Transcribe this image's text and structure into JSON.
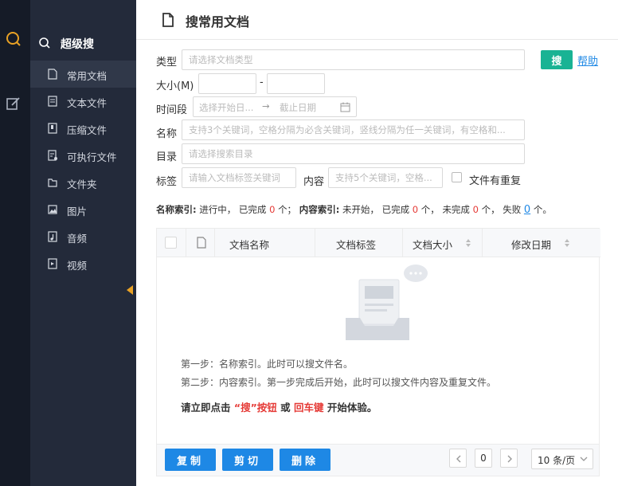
{
  "sidebar": {
    "title": "超级搜",
    "items": [
      {
        "label": "常用文档",
        "icon": "document-icon",
        "active": true
      },
      {
        "label": "文本文件",
        "icon": "text-file-icon"
      },
      {
        "label": "压缩文件",
        "icon": "archive-icon"
      },
      {
        "label": "可执行文件",
        "icon": "executable-icon"
      },
      {
        "label": "文件夹",
        "icon": "folder-icon"
      },
      {
        "label": "图片",
        "icon": "image-icon"
      },
      {
        "label": "音频",
        "icon": "audio-icon"
      },
      {
        "label": "视频",
        "icon": "video-icon"
      }
    ]
  },
  "page": {
    "title": "搜常用文档"
  },
  "form": {
    "type_label": "类型",
    "type_placeholder": "请选择文档类型",
    "size_label": "大小(M)",
    "size_sep": "-",
    "time_label": "时间段",
    "time_start_placeholder": "选择开始日...",
    "time_arrow": "→",
    "time_end_placeholder": "截止日期",
    "name_label": "名称",
    "name_placeholder": "支持3个关键词，空格分隔为必含关键词，竖线分隔为任一关键词，有空格和...",
    "dir_label": "目录",
    "dir_placeholder": "请选择搜索目录",
    "tag_label": "标签",
    "tag_placeholder": "请输入文档标签关键词",
    "content_label": "内容",
    "content_placeholder": "支持5个关键词，空格...",
    "dup_label": "文件有重复",
    "search_button": "搜",
    "help_link": "帮助"
  },
  "status": {
    "name_index_label": "名称索引:",
    "name_index_state": "进行中，",
    "done_prefix": "已完成",
    "name_done_count": "0",
    "unit_sep": "个；",
    "content_index_label": "内容索引:",
    "content_state": "未开始，",
    "content_done_count": "0",
    "unit": "个，",
    "undone_prefix": "未完成",
    "undone_count": "0",
    "fail_prefix": "失败",
    "fail_count": "0",
    "end": "个。"
  },
  "table": {
    "columns": [
      "文档名称",
      "文档标签",
      "文档大小",
      "修改日期"
    ],
    "step1": "第一步：名称索引。此时可以搜文件名。",
    "step2": "第二步：内容索引。第一步完成后开始，此时可以搜文件内容及重复文件。",
    "cta_prefix": "请立即点击",
    "cta_search": "“搜”按钮",
    "cta_or": "或",
    "cta_enter": "回车键",
    "cta_suffix": "开始体验。"
  },
  "footer": {
    "copy": "复制",
    "cut": "剪切",
    "delete": "删除",
    "current_page": "0",
    "page_size": "10 条/页"
  },
  "colors": {
    "accent": "#19b394",
    "primary": "#1e88e5",
    "sidebar": "#232a3a",
    "iconbar": "#151b27",
    "active_icon": "#e9a225"
  }
}
